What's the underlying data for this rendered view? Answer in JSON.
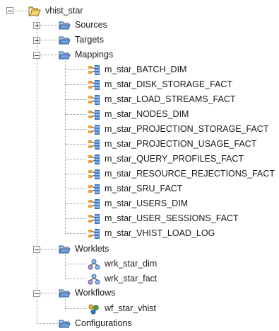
{
  "tree": {
    "root": {
      "label": "vhist_star",
      "icon": "folder-open-icon"
    },
    "folders": {
      "sources": {
        "label": "Sources"
      },
      "targets": {
        "label": "Targets"
      },
      "mappings": {
        "label": "Mappings",
        "items": [
          "m_star_BATCH_DIM",
          "m_star_DISK_STORAGE_FACT",
          "m_star_LOAD_STREAMS_FACT",
          "m_star_NODES_DIM",
          "m_star_PROJECTION_STORAGE_FACT",
          "m_star_PROJECTION_USAGE_FACT",
          "m_star_QUERY_PROFILES_FACT",
          "m_star_RESOURCE_REJECTIONS_FACT",
          "m_star_SRU_FACT",
          "m_star_USERS_DIM",
          "m_star_USER_SESSIONS_FACT",
          "m_star_VHIST_LOAD_LOG"
        ]
      },
      "worklets": {
        "label": "Worklets",
        "items": [
          "wrk_star_dim",
          "wrk_star_fact"
        ]
      },
      "workflows": {
        "label": "Workflows",
        "items": [
          "wf_star_vhist"
        ]
      },
      "configurations": {
        "label": "Configurations"
      }
    }
  },
  "colors": {
    "folder_fill": "#7fa8d8",
    "folder_outline": "#2e5a8c",
    "mapping_orange": "#f0a030",
    "mapping_blue": "#3a78c8",
    "workflow_green": "#46a53c"
  }
}
